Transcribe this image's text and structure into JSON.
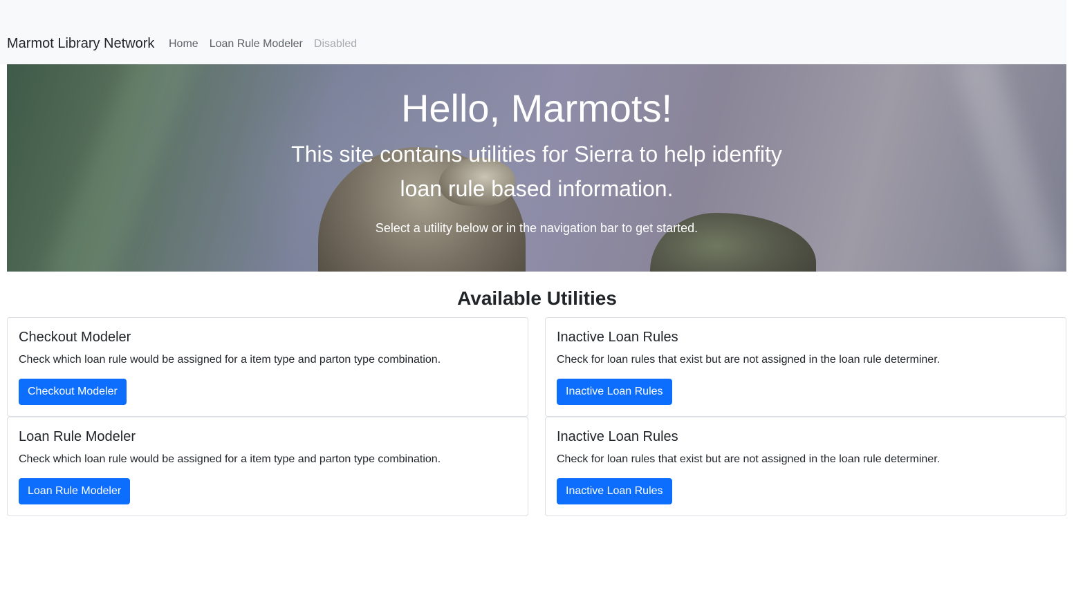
{
  "navbar": {
    "brand": "Marmot Library Network",
    "links": [
      {
        "label": "Home"
      },
      {
        "label": "Loan Rule Modeler"
      },
      {
        "label": "Disabled"
      }
    ]
  },
  "hero": {
    "title": "Hello, Marmots!",
    "lead_line1": "This site contains utilities for Sierra to help idenfity",
    "lead_line2": "loan rule based information.",
    "subtitle": "Select a utility below or in the navigation bar to get started."
  },
  "utilities": {
    "heading": "Available Utilities",
    "cards": [
      {
        "title": "Checkout Modeler",
        "text": "Check which loan rule would be assigned for a item type and parton type combination.",
        "button": "Checkout Modeler"
      },
      {
        "title": "Inactive Loan Rules",
        "text": "Check for loan rules that exist but are not assigned in the loan rule determiner.",
        "button": "Inactive Loan Rules"
      },
      {
        "title": "Loan Rule Modeler",
        "text": "Check which loan rule would be assigned for a item type and parton type combination.",
        "button": "Loan Rule Modeler"
      },
      {
        "title": "Inactive Loan Rules",
        "text": "Check for loan rules that exist but are not assigned in the loan rule determiner.",
        "button": "Inactive Loan Rules"
      }
    ]
  },
  "colors": {
    "primary": "#0d6efd",
    "navbar_bg": "#f8f9fa",
    "nav_link": "#5c6166",
    "nav_link_disabled": "#a6a9ad"
  }
}
